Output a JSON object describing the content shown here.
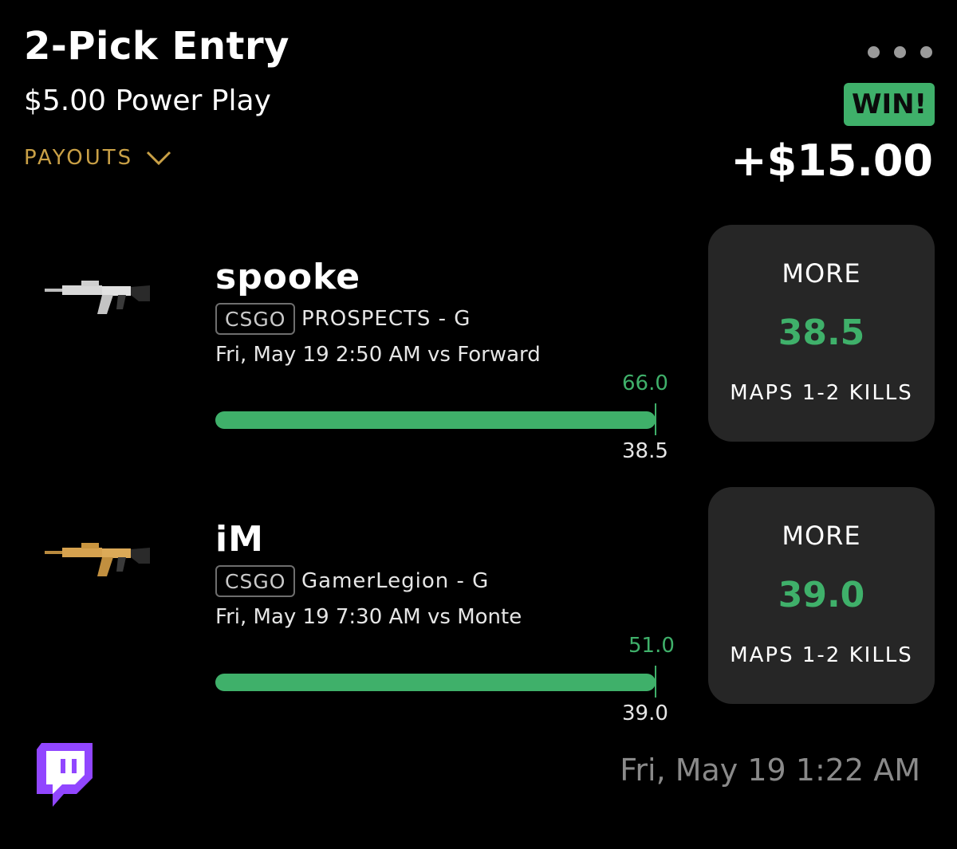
{
  "entry": {
    "title": "2-Pick Entry",
    "subtitle": "$5.00 Power Play",
    "payouts_label": "PAYOUTS",
    "result_badge": "WIN!",
    "result_amount": "+$15.00"
  },
  "colors": {
    "accent_green": "#3fb06a",
    "payouts_gold": "#c9a046",
    "card_bg": "#262626",
    "twitch_purple": "#9146ff"
  },
  "picks": [
    {
      "player": "spooke",
      "game_tag": "CSGO",
      "team": "PROSPECTS - G",
      "match_time": "Fri, May 19 2:50 AM  vs Forward",
      "actual_value": "66.0",
      "line_value": "38.5",
      "progress": 1.0,
      "weapon_icon": "silver-rifle-icon",
      "card": {
        "direction": "MORE",
        "line": "38.5",
        "stat": "MAPS 1-2 KILLS"
      }
    },
    {
      "player": "iM",
      "game_tag": "CSGO",
      "team": "GamerLegion - G",
      "match_time": "Fri, May 19 7:30 AM  vs Monte",
      "actual_value": "51.0",
      "line_value": "39.0",
      "progress": 1.0,
      "weapon_icon": "gold-rifle-icon",
      "card": {
        "direction": "MORE",
        "line": "39.0",
        "stat": "MAPS 1-2 KILLS"
      }
    }
  ],
  "footer": {
    "platform_icon": "twitch-icon",
    "timestamp": "Fri, May 19 1:22 AM"
  }
}
